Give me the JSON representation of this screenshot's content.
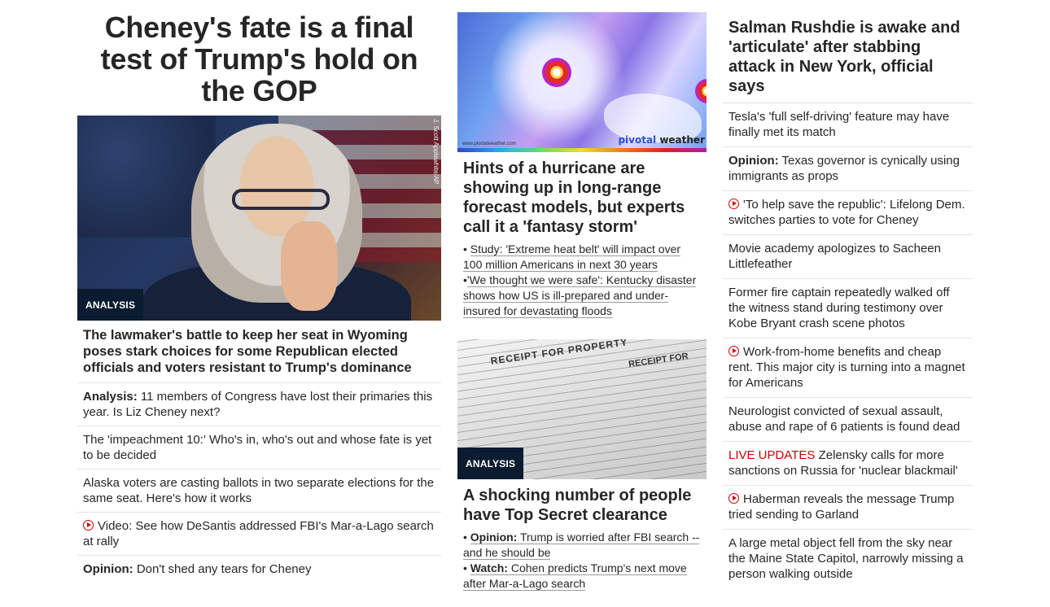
{
  "col1": {
    "headline": "Cheney's fate is a final test of Trump's hold on the GOP",
    "hero_credit": "J. Scott Applewhite/AP",
    "hero_badge": "ANALYSIS",
    "sub_headline": "The lawmaker's battle to keep her seat in Wyoming poses stark choices for some Republican elected officials and voters resistant to Trump's dominance",
    "items": [
      {
        "prefix": "Analysis:",
        "text": " 11 members of Congress have lost their primaries this year. Is Liz Cheney next?"
      },
      {
        "text": "The 'impeachment 10:' Who's in, who's out and whose fate is yet to be decided"
      },
      {
        "text": "Alaska voters are casting ballots in two separate elections for the same seat. Here's how it works"
      },
      {
        "icon": "play-icon",
        "text": "Video: See how DeSantis addressed FBI's Mar-a-Lago search at rally"
      },
      {
        "prefix": "Opinion:",
        "text": " Don't shed any tears for Cheney"
      }
    ]
  },
  "col2": {
    "map_brand_a": "pivotal",
    "map_brand_b": " weather",
    "map_url": "www.pivotalweather.com",
    "story1_headline": "Hints of a hurricane are showing up in long-range forecast models, but experts call it a 'fantasy storm'",
    "story1_bullets": [
      {
        "lead": "• ",
        "text": "Study: 'Extreme heat belt' will impact over 100 million Americans in next 30 years"
      },
      {
        "lead": "•",
        "text": "'We thought we were safe': Kentucky disaster shows how US is ill-prepared and under-insured for devastating floods"
      }
    ],
    "doc_title": "RECEIPT FOR PROPERTY",
    "doc_title2": "RECEIPT FOR",
    "story2_badge": "ANALYSIS",
    "story2_headline": "A shocking number of people have Top Secret clearance",
    "story2_bullets": [
      {
        "lead": "• ",
        "prefix": "Opinion:",
        "text": " Trump is worried after FBI search -- and he should be"
      },
      {
        "lead": "• ",
        "prefix": "Watch:",
        "text": " Cohen predicts Trump's next move after Mar-a-Lago search"
      }
    ]
  },
  "col3": {
    "headline": "Salman Rushdie is awake and 'articulate' after stabbing attack in New York, official says",
    "items": [
      {
        "text": "Tesla's 'full self-driving' feature may have finally met its match"
      },
      {
        "prefix": "Opinion:",
        "text": " Texas governor is cynically using immigrants as props"
      },
      {
        "icon": "play-icon",
        "text": "'To help save the republic': Lifelong Dem. switches parties to vote for Cheney"
      },
      {
        "text": "Movie academy apologizes to Sacheen Littlefeather"
      },
      {
        "text": "Former fire captain repeatedly walked off the witness stand during testimony over Kobe Bryant crash scene photos"
      },
      {
        "icon": "play-icon",
        "text": "Work-from-home benefits and cheap rent. This major city is turning into a magnet for Americans"
      },
      {
        "text": "Neurologist convicted of sexual assault, abuse and rape of 6 patients is found dead"
      },
      {
        "live": "LIVE UPDATES",
        "text": " Zelensky calls for more sanctions on Russia for 'nuclear blackmail'"
      },
      {
        "icon": "play-icon",
        "text": "Haberman reveals the message Trump tried sending to Garland"
      },
      {
        "text": "A large metal object fell from the sky near the Maine State Capitol, narrowly missing a person walking outside"
      }
    ]
  },
  "colors": {
    "accent_red": "#cc0000",
    "badge_bg": "#0c1c30",
    "text": "#262626"
  }
}
